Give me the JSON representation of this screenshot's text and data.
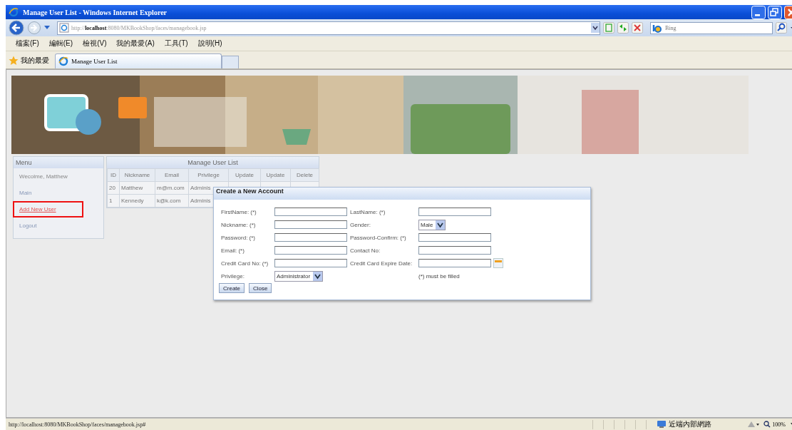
{
  "window": {
    "title": "Manage User List - Windows Internet Explorer"
  },
  "address_bar": {
    "url": "http://**localhost**:8080/MKBookShop/faces/managebook.jsp",
    "search_placeholder": "Bing"
  },
  "menu_bar": [
    "檔案(F)",
    "編輯(E)",
    "檢視(V)",
    "我的最愛(A)",
    "工具(T)",
    "說明(H)"
  ],
  "favorites_bar": {
    "label": "我的最愛",
    "tabs": [
      {
        "label": "Manage User List",
        "selected": true
      }
    ]
  },
  "menu": {
    "title": "Menu",
    "items": [
      {
        "text": "Wecolme, Matthew",
        "kind": "text",
        "highlighted": false
      },
      {
        "text": "Main",
        "kind": "link",
        "highlighted": false
      },
      {
        "text": "Add New User",
        "kind": "link",
        "highlighted": true
      },
      {
        "text": "Logout",
        "kind": "link",
        "highlighted": false
      }
    ]
  },
  "table": {
    "title": "Manage User List",
    "columns": [
      "ID",
      "Nickname",
      "Email",
      "Privilege",
      "Update",
      "Update",
      "Delete"
    ],
    "rows": [
      [
        "20",
        "Matthew",
        "m@m.com",
        "Adminis"
      ],
      [
        "1",
        "Kennedy",
        "k@k.com",
        "Adminis"
      ]
    ]
  },
  "dialog": {
    "title": "Create a New Account",
    "rows": [
      [
        {
          "kind": "text",
          "label": "FirstName: (*)"
        },
        {
          "kind": "text",
          "label": "LastName: (*)"
        }
      ],
      [
        {
          "kind": "text",
          "label": "Nickname: (*)"
        },
        {
          "kind": "select",
          "label": "Gender:",
          "value": "Male"
        }
      ],
      [
        {
          "kind": "text",
          "label": "Password: (*)"
        },
        {
          "kind": "text",
          "label": "Password-Confirm: (*)"
        }
      ],
      [
        {
          "kind": "text",
          "label": "Email: (*)"
        },
        {
          "kind": "text",
          "label": "Contact No:"
        }
      ],
      [
        {
          "kind": "text",
          "label": "Credit Card No: (*)"
        },
        {
          "kind": "date",
          "label": "Credit Card Expire Date:"
        }
      ],
      [
        {
          "kind": "select",
          "label": "Privilege:",
          "value": "Administrator"
        },
        {
          "kind": "note",
          "text": "(*) must be filled"
        }
      ]
    ],
    "buttons": [
      "Create",
      "Close"
    ]
  },
  "status_bar": {
    "url": "http://localhost:8080/MKBookShop/faces/managebook.jsp#",
    "zone": "近端內部網路",
    "zoom": "100%"
  }
}
